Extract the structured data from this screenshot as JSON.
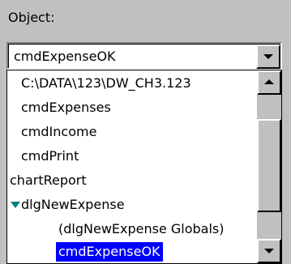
{
  "object_label": "Object:",
  "combo": {
    "value": "cmdExpenseOK"
  },
  "dropdown": {
    "items": [
      {
        "label": "C:\\DATA\\123\\DW_CH3.123",
        "selected": false
      },
      {
        "label": "cmdExpenses",
        "selected": false
      },
      {
        "label": "cmdIncome",
        "selected": false
      },
      {
        "label": "cmdPrint",
        "selected": false
      },
      {
        "label": "chartReport",
        "selected": false
      },
      {
        "label": "dlgNewExpense",
        "selected": false,
        "expanded": true
      },
      {
        "label": "(dlgNewExpense Globals)",
        "selected": false
      },
      {
        "label": "cmdExpenseOK",
        "selected": true
      }
    ]
  },
  "icons": {
    "combo_arrow": "chevron-down-icon",
    "scroll_up": "scroll-up-arrow-icon",
    "scroll_down": "scroll-down-arrow-icon",
    "expand": "tree-expanded-icon"
  },
  "colors": {
    "selection": "#0000ff",
    "expand_icon": "#008080"
  }
}
